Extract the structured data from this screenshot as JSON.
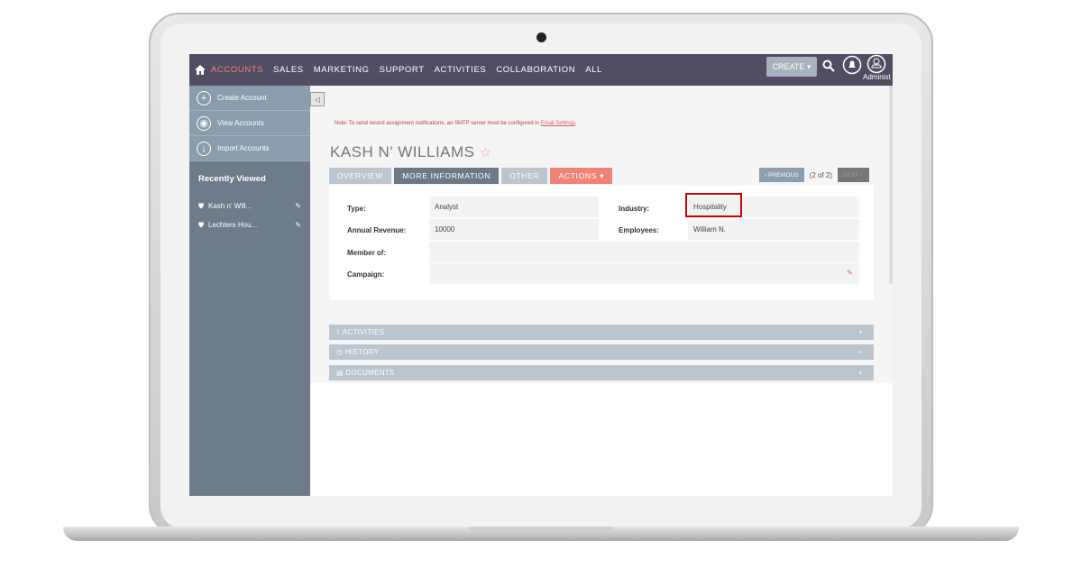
{
  "nav": {
    "items": [
      "ACCOUNTS",
      "SALES",
      "MARKETING",
      "SUPPORT",
      "ACTIVITIES",
      "COLLABORATION",
      "ALL"
    ],
    "create": "CREATE",
    "user": "Administ"
  },
  "sidebar": {
    "actions": [
      {
        "label": "Create Account",
        "icon": "plus-icon"
      },
      {
        "label": "View Accounts",
        "icon": "eye-icon"
      },
      {
        "label": "Import Accounts",
        "icon": "download-icon"
      }
    ],
    "recent_title": "Recently Viewed",
    "recent": [
      "Kash n' Will...",
      "Lechters Hou..."
    ]
  },
  "main": {
    "note": "Note: To send record assignment notifications, an SMTP server must be configured in ",
    "note_link": "Email Settings",
    "note_end": ".",
    "title": "KASH N' WILLIAMS",
    "tabs": [
      "OVERVIEW",
      "MORE INFORMATION",
      "OTHER",
      "ACTIONS"
    ],
    "pager": {
      "previous": "PREVIOUS",
      "count": "(2 of 2)",
      "next": "NEXT"
    },
    "fields": {
      "type_label": "Type:",
      "type": "Analyst",
      "industry_label": "Industry:",
      "industry": "Hospitality",
      "revenue_label": "Annual Revenue:",
      "revenue": "10000",
      "employees_label": "Employees:",
      "employees": "William N.",
      "member_label": "Member of:",
      "member": "",
      "campaign_label": "Campaign:",
      "campaign": ""
    },
    "subpanels": [
      "ACTIVITIES",
      "HISTORY",
      "DOCUMENTS"
    ]
  },
  "colors": {
    "nav": "#534d64",
    "accent": "#f08377",
    "sidebar": "#6d7b8a",
    "highlight": "#d00000"
  }
}
